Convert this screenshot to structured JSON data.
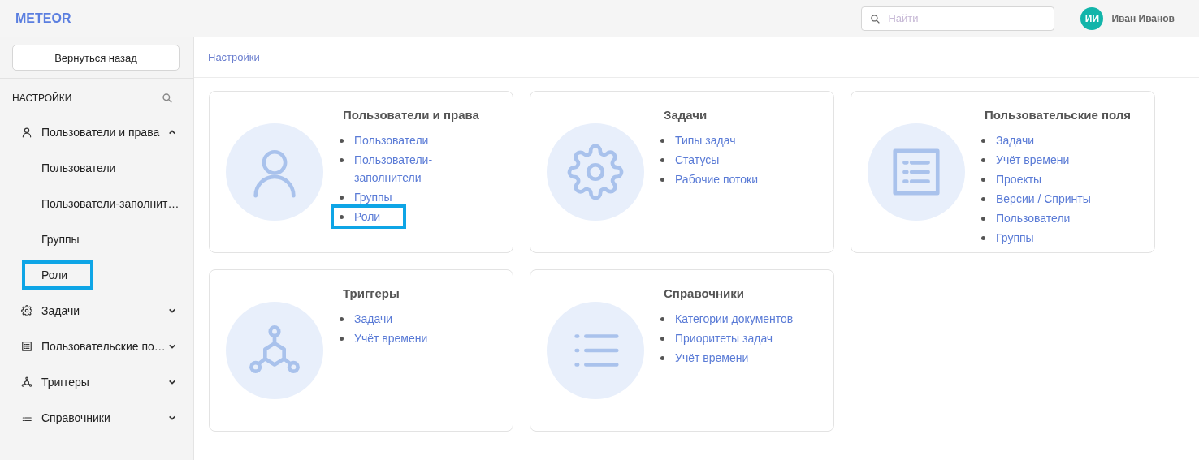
{
  "header": {
    "logo": "METEOR",
    "search": {
      "placeholder": "Найти"
    },
    "user": {
      "initials": "ИИ",
      "name": "Иван Иванов"
    }
  },
  "sidebar": {
    "back_button": "Вернуться назад",
    "title": "НАСТРОЙКИ",
    "sections": [
      {
        "label": "Пользователи и права",
        "kind": "user",
        "expanded": true,
        "children": [
          {
            "label": "Пользователи",
            "highlighted": false
          },
          {
            "label": "Пользователи-заполнит…",
            "highlighted": false
          },
          {
            "label": "Группы",
            "highlighted": false
          },
          {
            "label": "Роли",
            "highlighted": true
          }
        ]
      },
      {
        "label": "Задачи",
        "kind": "gear",
        "expanded": false
      },
      {
        "label": "Пользовательские по…",
        "kind": "form",
        "expanded": false
      },
      {
        "label": "Триггеры",
        "kind": "network",
        "expanded": false
      },
      {
        "label": "Справочники",
        "kind": "list",
        "expanded": false
      }
    ]
  },
  "breadcrumb": "Настройки",
  "cards": [
    {
      "title": "Пользователи и права",
      "kind": "user",
      "links": [
        {
          "label": "Пользователи",
          "highlighted": false
        },
        {
          "label": "Пользователи-заполнители",
          "highlighted": false
        },
        {
          "label": "Группы",
          "highlighted": false
        },
        {
          "label": "Роли",
          "highlighted": true
        }
      ]
    },
    {
      "title": "Задачи",
      "kind": "gear",
      "links": [
        {
          "label": "Типы задач",
          "highlighted": false
        },
        {
          "label": "Статусы",
          "highlighted": false
        },
        {
          "label": "Рабочие потоки",
          "highlighted": false
        }
      ]
    },
    {
      "title": "Пользовательские поля",
      "kind": "form",
      "links": [
        {
          "label": "Задачи",
          "highlighted": false
        },
        {
          "label": "Учёт времени",
          "highlighted": false
        },
        {
          "label": "Проекты",
          "highlighted": false
        },
        {
          "label": "Версии / Спринты",
          "highlighted": false
        },
        {
          "label": "Пользователи",
          "highlighted": false
        },
        {
          "label": "Группы",
          "highlighted": false
        }
      ]
    },
    {
      "title": "Триггеры",
      "kind": "network",
      "links": [
        {
          "label": "Задачи",
          "highlighted": false
        },
        {
          "label": "Учёт времени",
          "highlighted": false
        }
      ]
    },
    {
      "title": "Справочники",
      "kind": "list",
      "links": [
        {
          "label": "Категории документов",
          "highlighted": false
        },
        {
          "label": "Приоритеты задач",
          "highlighted": false
        },
        {
          "label": "Учёт времени",
          "highlighted": false
        }
      ]
    }
  ]
}
